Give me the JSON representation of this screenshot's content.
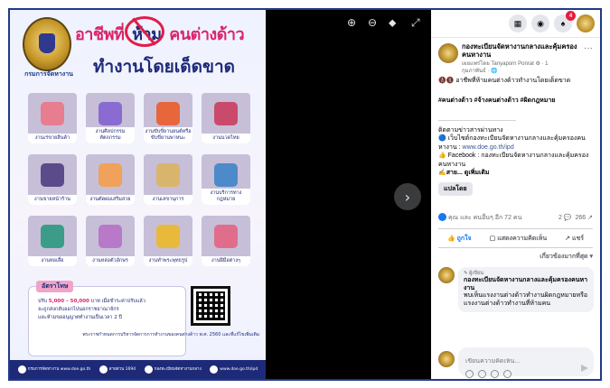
{
  "poster": {
    "org_short": "กรมการจัดหางาน",
    "headline_a": "อาชีพที่",
    "headline_ban": "ห้าม",
    "headline_b": "คนต่างด้าว",
    "headline_2": "ทำงานโดยเด็ดขาด",
    "tiles": [
      {
        "label": "งานเร่ขายสินค้า",
        "color": "#e77d8f"
      },
      {
        "label": "งานศิลปกรรมหัตถกรรม",
        "color": "#8a6bd1"
      },
      {
        "label": "งานขับขี่ยานยนต์หรือขับขี่ยานพาหนะ",
        "color": "#e8663b"
      },
      {
        "label": "งานนวดไทย",
        "color": "#c94a6a"
      },
      {
        "label": "งานขายหน้าร้าน",
        "color": "#5c4b8a"
      },
      {
        "label": "งานตัดผมเสริมสวย",
        "color": "#f0a15a"
      },
      {
        "label": "งานเลขานุการ",
        "color": "#d8b56a"
      },
      {
        "label": "งานบริการทางกฎหมาย",
        "color": "#4d8ac9"
      },
      {
        "label": "งานทอเสื่อ",
        "color": "#3b9c8a"
      },
      {
        "label": "งานหล่อตัวอักษร",
        "color": "#b879c9"
      },
      {
        "label": "งานทำพระพุทธรูป",
        "color": "#e8b93b"
      },
      {
        "label": "งานฝีมือต่างๆ",
        "color": "#e06d8b"
      }
    ],
    "fine_title": "อัตราโทษ",
    "fine_amount": "5,000 – 50,000",
    "fine_line_1": "บาท เมื่อชำระค่าปรับแล้ว",
    "fine_line_2": "จะถูกส่งกลับออกไปนอกราชอาณาจักร",
    "fine_line_3": "และห้ามขออนุญาตทำงานเป็นเวลา 2 ปี",
    "law_note": "พระราชกำหนดการบริหารจัดการการทำงานของคนต่างด้าว พ.ศ. 2560 และที่แก้ไขเพิ่มเติม",
    "footer": [
      {
        "label": "กรมการจัดหางาน www.doe.go.th"
      },
      {
        "label": "สายด่วน 1694"
      },
      {
        "label": "กองทะเบียนจัดหางานกลาง"
      },
      {
        "label": "www.doe.go.th/ipd"
      }
    ]
  },
  "viewer": {
    "zoom_in": "⊕",
    "zoom_out": "⊖",
    "tag": "⬥",
    "fullscreen": "⤢",
    "next": "›"
  },
  "topbar": {
    "notif_count": "4"
  },
  "post": {
    "page_name": "กองทะเบียนจัดหางานกลางและคุ้มครองคนหางาน",
    "meta_line_1": "เผยแพร่โดย Tanyaporn Ponrat ⚙ · 1",
    "meta_line_2": "กุมภาพันธ์ · 🌐",
    "body_line_1": "🚷🚷 อาชีพที่ห้ามคนต่างด้าวทำงานโดยเด็ดขาด",
    "hashtags": "#คนต่างด้าว #จ้างคนต่างด้าว #ผิดกฎหมาย",
    "divider": "-------------------------------------------",
    "contact_line": "ติดตามข่าวสารผ่านทาง",
    "web_prefix": "🔵 เว็บไซต์กองทะเบียนจัดหางานกลางและคุ้มครองคนหางาน : ",
    "web_link": "www.doe.go.th/ipd",
    "fb_line": "👍 Facebook : กองทะเบียนจัดหางานกลางและคุ้มครองคนหางาน",
    "see_more": "✍สาย... ดูเพิ่มเติม",
    "translate": "แปลโดย"
  },
  "reactions": {
    "summary": "คุณ และ คนอื่นๆ อีก 72 คน",
    "comments": "2 💬",
    "shares": "266 ↗"
  },
  "actions": {
    "like": "ถูกใจ",
    "comment": "แสดงความคิดเห็น",
    "share": "แชร์"
  },
  "comments": {
    "sort_label": "เกี่ยวข้องมากที่สุด ▾",
    "items": [
      {
        "role": "✎ ผู้เขียน",
        "author": "กองทะเบียนจัดหางานกลางและคุ้มครองคนหางาน",
        "text": "พบเห็นแรงงานต่างด้าวทำงานผิดกฎหมายหรือแรงงานต่างด้าวทำงานที่ห้ามคน"
      }
    ]
  },
  "composer": {
    "placeholder": "เขียนความคิดเห็น..."
  }
}
